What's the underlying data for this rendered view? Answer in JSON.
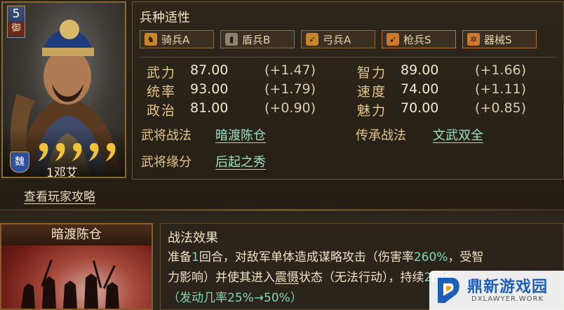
{
  "portrait": {
    "cost": "5",
    "cost_type": "御",
    "faction": "魏",
    "stars": "❨❨❨❨❨",
    "name": "1邓艾",
    "guide_link": "查看玩家攻略"
  },
  "adaptability": {
    "title": "兵种适性",
    "items": [
      {
        "label": "骑兵A",
        "icon": "horse-icon"
      },
      {
        "label": "盾兵B",
        "icon": "shield-icon"
      },
      {
        "label": "弓兵A",
        "icon": "bow-icon"
      },
      {
        "label": "枪兵S",
        "icon": "spear-icon"
      },
      {
        "label": "器械S",
        "icon": "siege-wheel-icon"
      }
    ]
  },
  "stats": [
    {
      "name": "武力",
      "value": "87.00",
      "bonus": "(+1.47)"
    },
    {
      "name": "智力",
      "value": "89.00",
      "bonus": "(+1.66)"
    },
    {
      "name": "统率",
      "value": "93.00",
      "bonus": "(+1.79)"
    },
    {
      "name": "速度",
      "value": "74.00",
      "bonus": "(+1.11)"
    },
    {
      "name": "政治",
      "value": "81.00",
      "bonus": "(+0.90)"
    },
    {
      "name": "魅力",
      "value": "70.00",
      "bonus": "(+0.85)"
    }
  ],
  "tactics": {
    "general_label": "武将战法",
    "general_value": "暗渡陈仓",
    "inherit_label": "传承战法",
    "inherit_value": "文武双全",
    "bond_label": "武将缘分",
    "bond_value": "后起之秀"
  },
  "skill": {
    "card_title": "暗渡陈仓",
    "effect_title": "战法效果",
    "line1_a": "准备",
    "line1_num1": "1",
    "line1_b": "回合，对敌军单体造成谋略攻击（伤害率",
    "line1_num2": "260%",
    "line1_c": "，受智",
    "line2_a": "力影响）并使其进入",
    "line2_kw": "震慑",
    "line2_b": "状态（无法行动），持续",
    "line2_num": "2",
    "line2_c": "回合",
    "chance": "（发动几率25%→50%）"
  },
  "watermark": {
    "name": "鼎新游戏园",
    "url": "DXLAWYER.WORK"
  }
}
